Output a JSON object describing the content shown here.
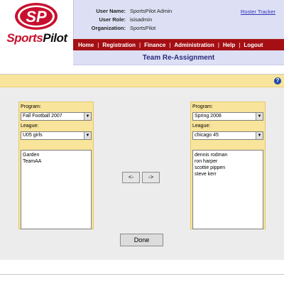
{
  "logo": {
    "initials": "SP",
    "word_sports": "Sports",
    "word_pilot": "Pilot"
  },
  "user_info": {
    "rows": [
      {
        "key": "User Name:",
        "value": "SportsPilot Admin"
      },
      {
        "key": "User Role:",
        "value": "isisadmin"
      },
      {
        "key": "Organization:",
        "value": "SportsPilot"
      }
    ],
    "roster_link": "Roster Tracker"
  },
  "nav": {
    "items": [
      "Home",
      "Registration",
      "Finance",
      "Administration",
      "Help",
      "Logout"
    ],
    "separator": "|"
  },
  "page_title": "Team Re-Assignment",
  "help_icon": "?",
  "left_panel": {
    "program_label": "Program:",
    "program_value": "Fall Football 2007",
    "league_label": "League:",
    "league_value": "U05 girls",
    "teams": [
      "Garden",
      "TeamAA"
    ]
  },
  "right_panel": {
    "program_label": "Program:",
    "program_value": "Spring 2008",
    "league_label": "League:",
    "league_value": "chicago 45",
    "players": [
      "dennis rodman",
      "ron harper",
      "scottie pippen",
      "steve kerr"
    ]
  },
  "buttons": {
    "move_left": "<-",
    "move_right": "->",
    "done": "Done"
  },
  "colors": {
    "brand_red": "#a50f14",
    "header_lavender": "#dde0f4",
    "panel_yellow": "#f8e49a"
  }
}
